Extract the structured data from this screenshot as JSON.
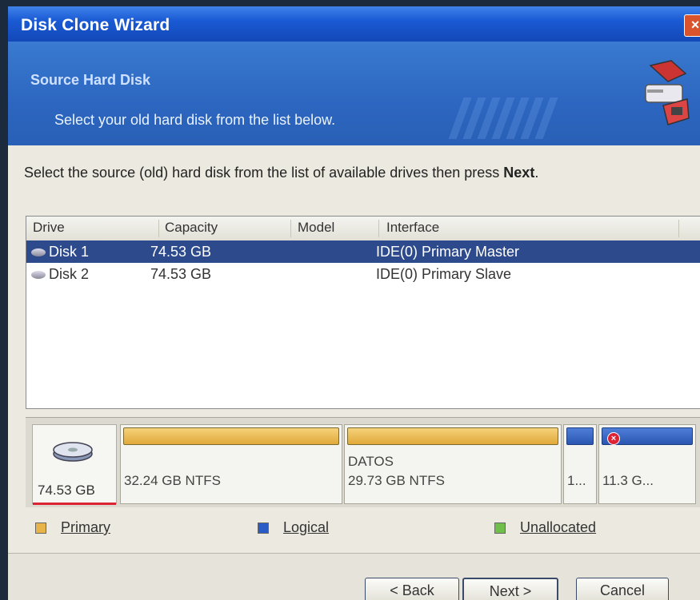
{
  "window": {
    "title": "Disk Clone Wizard",
    "close_glyph": "×"
  },
  "header": {
    "title": "Source Hard Disk",
    "subtitle": "Select your old hard disk from the list below."
  },
  "instruction": {
    "text": "Select the source (old) hard disk from the list of available drives then press",
    "bold": "Next",
    "suffix": "."
  },
  "table": {
    "columns": [
      "Drive",
      "Capacity",
      "Model",
      "Interface"
    ],
    "rows": [
      {
        "drive": "Disk 1",
        "capacity": "74.53 GB",
        "model": "",
        "interface": "IDE(0) Primary Master",
        "selected": true
      },
      {
        "drive": "Disk 2",
        "capacity": "74.53 GB",
        "model": "",
        "interface": "IDE(0) Primary Slave",
        "selected": false
      }
    ]
  },
  "disk_map": {
    "disk_size": "74.53 GB",
    "partitions": [
      {
        "type": "primary",
        "label": "",
        "size": "32.24 GB NTFS"
      },
      {
        "type": "primary",
        "label": "DATOS",
        "size": "29.73 GB NTFS"
      },
      {
        "type": "logical",
        "label": "",
        "size": "1..."
      },
      {
        "type": "logical",
        "label": "",
        "size": "11.3 G..."
      }
    ]
  },
  "legend": {
    "primary": "Primary",
    "logical": "Logical",
    "unallocated": "Unallocated"
  },
  "colors": {
    "primary": "#e8b44a",
    "logical": "#2a5cc8",
    "unallocated": "#6fbf4a",
    "selection": "#2c4a8c"
  },
  "buttons": {
    "back": "< Back",
    "next": "Next >",
    "cancel": "Cancel"
  }
}
